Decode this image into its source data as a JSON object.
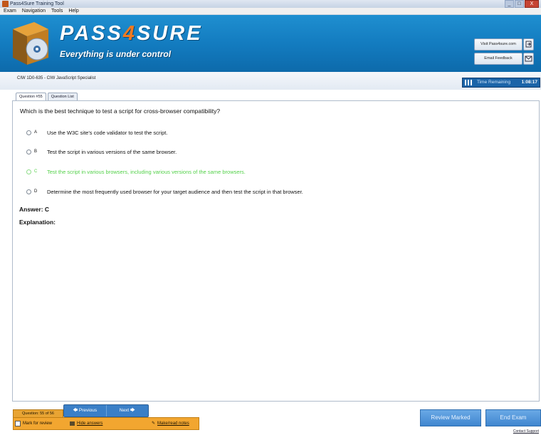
{
  "window": {
    "title": "Pass4Sure Training Tool",
    "controls": [
      "_",
      "□",
      "X"
    ]
  },
  "menu": [
    "Exam",
    "Navigation",
    "Tools",
    "Help"
  ],
  "banner": {
    "brand_left": "PASS",
    "brand_num": "4",
    "brand_right": "SURE",
    "tagline": "Everything is under control",
    "visit_button": "Visit Pass4sure.com",
    "feedback_button": "Email Feedback",
    "icons": [
      "exit-icon",
      "mail-icon"
    ]
  },
  "exam": {
    "code": "CIW 1D0-635 - CIW JavaScript Specialist",
    "time_label": "Time Remaining",
    "time_value": "1:08:17"
  },
  "tabs": [
    "Question #55",
    "Question List"
  ],
  "question": {
    "text": "Which is the best technique to test a script for cross-browser compatibility?",
    "options": [
      {
        "letter": "A",
        "text": "Use the W3C site's code validator to test the script."
      },
      {
        "letter": "B",
        "text": "Test the script in various versions of the same browser."
      },
      {
        "letter": "C",
        "text": "Test the script in various browsers, including various versions of the same browsers."
      },
      {
        "letter": "D",
        "text": "Determine the most frequently used browser for your target audience and then test the script in that browser."
      }
    ],
    "correct_color": "#54d14a",
    "answer": "Answer: C",
    "explanation": "Explanation:"
  },
  "bottom": {
    "counter": "Question: 55 of 56",
    "previous": "Previous",
    "next": "Next",
    "mark_review": "Mark for review",
    "hide_answers": "Hide answers",
    "make_notes": "Make/read notes",
    "review_marked": "Review Marked",
    "end_exam": "End Exam",
    "contact": "Contact Support"
  }
}
